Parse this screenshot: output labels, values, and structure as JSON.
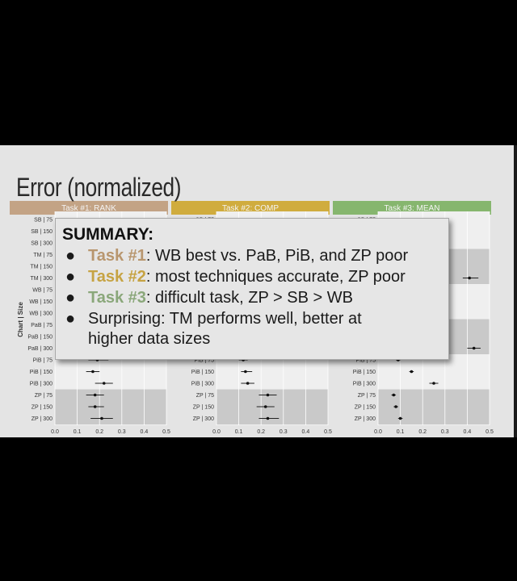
{
  "slide": {
    "title": "Error (normalized)"
  },
  "summary": {
    "heading": "SUMMARY:",
    "items": [
      {
        "task": "Task #1",
        "text": ": WB best vs. PaB, PiB, and ZP poor",
        "color": "#b8966e"
      },
      {
        "task": "Task #2",
        "text": ": most techniques accurate, ZP poor",
        "color": "#c6a343"
      },
      {
        "task": "Task #3",
        "text": ": difficult task, ZP > SB > WB",
        "color": "#8aa77a"
      },
      {
        "task": "",
        "text": "Surprising: TM performs well, better at",
        "color": "#1a1a1a"
      }
    ],
    "continuation": "higher data sizes"
  },
  "chart_data": {
    "type": "scatter",
    "panels": [
      {
        "title": "Task #1: RANK",
        "header_color": "#c3a385",
        "estimates": [
          null,
          null,
          null,
          null,
          null,
          null,
          null,
          null,
          null,
          null,
          null,
          null,
          0.19,
          0.17,
          0.22,
          0.18,
          0.18,
          0.21
        ],
        "ci_low": [
          null,
          null,
          null,
          null,
          null,
          null,
          null,
          null,
          null,
          null,
          null,
          null,
          0.15,
          0.14,
          0.18,
          0.14,
          0.15,
          0.16
        ],
        "ci_high": [
          null,
          null,
          null,
          null,
          null,
          null,
          null,
          null,
          null,
          null,
          null,
          null,
          0.24,
          0.2,
          0.26,
          0.22,
          0.22,
          0.26
        ]
      },
      {
        "title": "Task #2: COMP",
        "header_color": "#d0ac3e",
        "estimates": [
          null,
          null,
          null,
          null,
          null,
          null,
          null,
          null,
          null,
          null,
          null,
          null,
          0.12,
          0.13,
          0.14,
          0.23,
          0.22,
          0.23
        ],
        "ci_low": [
          null,
          null,
          null,
          null,
          null,
          null,
          null,
          null,
          null,
          null,
          null,
          null,
          0.1,
          0.11,
          0.11,
          0.19,
          0.18,
          0.19
        ],
        "ci_high": [
          null,
          null,
          null,
          null,
          null,
          null,
          null,
          null,
          null,
          null,
          null,
          null,
          0.14,
          0.16,
          0.17,
          0.27,
          0.26,
          0.28
        ]
      },
      {
        "title": "Task #3: MEAN",
        "header_color": "#86b66e",
        "estimates": [
          null,
          null,
          null,
          null,
          null,
          0.41,
          null,
          null,
          null,
          null,
          null,
          0.43,
          0.09,
          0.15,
          0.25,
          0.07,
          0.08,
          0.1
        ],
        "ci_low": [
          null,
          null,
          null,
          null,
          null,
          0.38,
          null,
          null,
          null,
          null,
          null,
          0.4,
          0.08,
          0.14,
          0.23,
          0.06,
          0.07,
          0.09
        ],
        "ci_high": [
          null,
          null,
          null,
          null,
          null,
          0.45,
          null,
          null,
          null,
          null,
          null,
          0.46,
          0.1,
          0.16,
          0.27,
          0.08,
          0.09,
          0.11
        ]
      }
    ],
    "rows": [
      "SB | 75",
      "SB | 150",
      "SB | 300",
      "TM | 75",
      "TM | 150",
      "TM | 300",
      "WB | 75",
      "WB | 150",
      "WB | 300",
      "PaB | 75",
      "PaB | 150",
      "PaB | 300",
      "PiB | 75",
      "PiB | 150",
      "PiB | 300",
      "ZP | 75",
      "ZP | 150",
      "ZP | 300"
    ],
    "shaded_groups": [
      "TM",
      "PaB",
      "ZP"
    ],
    "y_axis_label": "Chart | Size",
    "x_ticks": [
      "0.0",
      "0.1",
      "0.2",
      "0.3",
      "0.4",
      "0.5"
    ],
    "xlim": [
      0,
      0.5
    ],
    "grid": true
  }
}
